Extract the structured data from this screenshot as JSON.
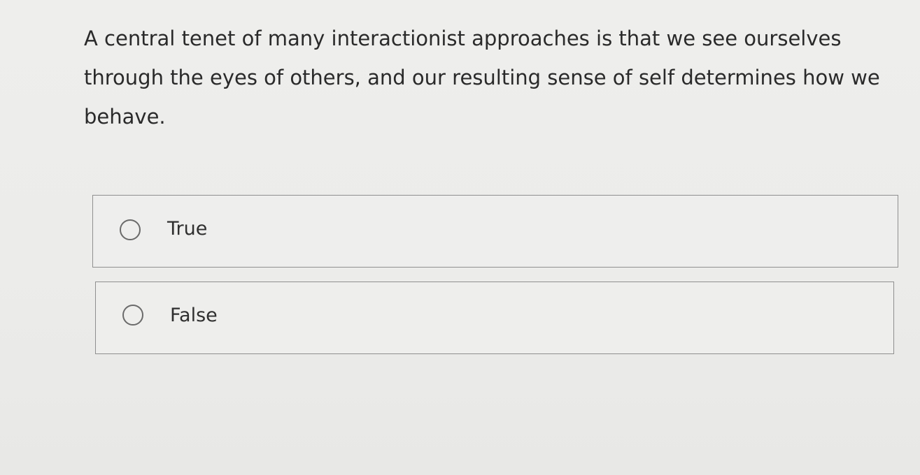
{
  "question": {
    "text": "A central tenet of many interactionist approaches is that we see ourselves through the eyes of others, and our resulting sense of self determines how we behave."
  },
  "options": [
    {
      "label": "True",
      "selected": false
    },
    {
      "label": "False",
      "selected": false
    }
  ]
}
